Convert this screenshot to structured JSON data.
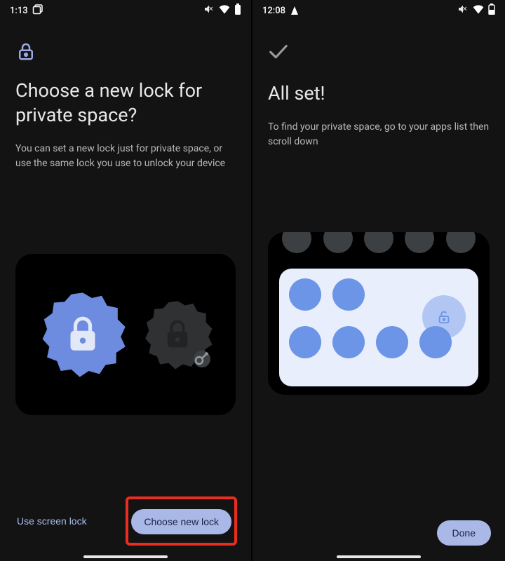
{
  "left": {
    "status": {
      "time": "1:13"
    },
    "title": "Choose a new lock for private space?",
    "description": "You can set a new lock just for private space, or use the same lock you use to unlock your device",
    "btn_flat": "Use screen lock",
    "btn_primary": "Choose new lock"
  },
  "right": {
    "status": {
      "time": "12:08"
    },
    "title": "All set!",
    "description": "To find your private space, go to your apps list then scroll down",
    "btn_primary": "Done"
  }
}
